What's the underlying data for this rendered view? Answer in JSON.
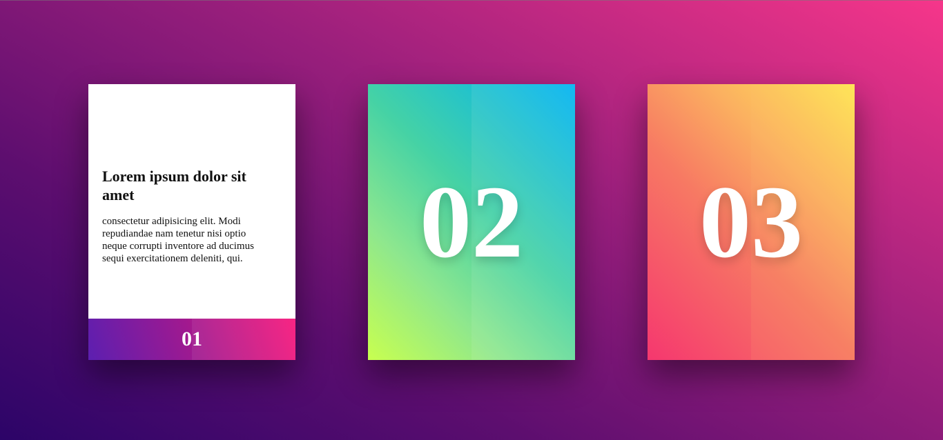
{
  "cards": [
    {
      "title": "Lorem ipsum dolor sit amet",
      "text": "consectetur adipisicing elit. Modi repudiandae nam tenetur nisi optio neque corrupti inventore ad ducimus sequi exercitationem deleniti, qui.",
      "number": "01"
    },
    {
      "number": "02"
    },
    {
      "number": "03"
    }
  ],
  "colors": {
    "background_start": "#2c0468",
    "background_end": "#f6368a",
    "card2_start": "#c8ff4f",
    "card2_end": "#00b3f2",
    "card3_start": "#f5376f",
    "card3_end": "#fee955",
    "card1_footer_start": "#5c1fb0",
    "card1_footer_end": "#f8157a"
  }
}
